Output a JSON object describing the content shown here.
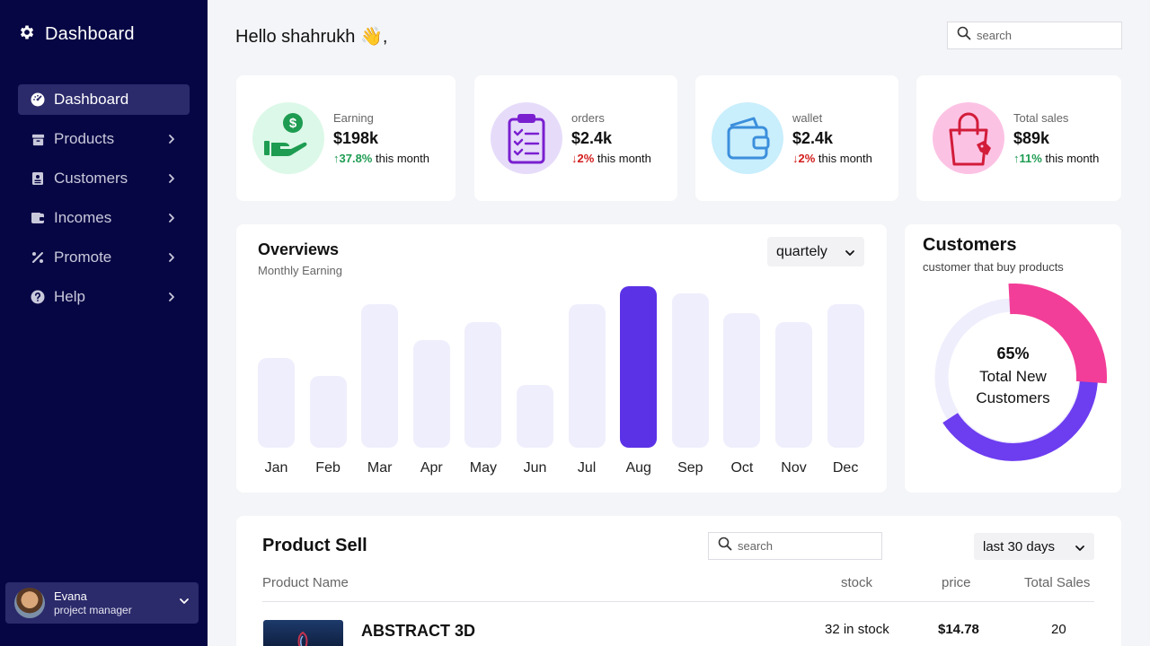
{
  "sidebar": {
    "brand": "Dashboard",
    "items": [
      {
        "label": "Dashboard",
        "icon": "gauge-icon",
        "active": true
      },
      {
        "label": "Products",
        "icon": "box-icon",
        "active": false
      },
      {
        "label": "Customers",
        "icon": "id-card-icon",
        "active": false
      },
      {
        "label": "Incomes",
        "icon": "wallet-icon",
        "active": false
      },
      {
        "label": "Promote",
        "icon": "percent-icon",
        "active": false
      },
      {
        "label": "Help",
        "icon": "question-icon",
        "active": false
      }
    ],
    "profile": {
      "name": "Evana",
      "role": "project manager"
    }
  },
  "header": {
    "greeting": "Hello shahrukh 👋,",
    "search_placeholder": "search"
  },
  "stats": [
    {
      "label": "Earning",
      "value": "$198k",
      "change": "37.8%",
      "direction": "up",
      "suffix": " this month",
      "icon": "dollar-hand-icon",
      "bg": "#dcf8e8",
      "color": "#1e9c52"
    },
    {
      "label": "orders",
      "value": "$2.4k",
      "change": "2%",
      "direction": "down",
      "suffix": " this month",
      "icon": "clipboard-icon",
      "bg": "#e6dcfa",
      "color": "#7a1fd0"
    },
    {
      "label": "wallet",
      "value": "$2.4k",
      "change": "2%",
      "direction": "down",
      "suffix": " this month",
      "icon": "wallet-icon",
      "bg": "#c9eefc",
      "color": "#3b8fdc"
    },
    {
      "label": "Total sales",
      "value": "$89k",
      "change": "11%",
      "direction": "up",
      "suffix": " this month",
      "icon": "shopping-bag-icon",
      "bg": "#fcc2e4",
      "color": "#d21c3a"
    }
  ],
  "overview": {
    "title": "Overviews",
    "subtitle": "Monthly Earning",
    "period": "quartely"
  },
  "chart_data": {
    "type": "bar",
    "categories": [
      "Jan",
      "Feb",
      "Mar",
      "Apr",
      "May",
      "Jun",
      "Jul",
      "Aug",
      "Sep",
      "Oct",
      "Nov",
      "Dec"
    ],
    "values": [
      50,
      40,
      80,
      60,
      70,
      35,
      80,
      90,
      86,
      75,
      70,
      80
    ],
    "highlight": "Aug",
    "highlight_color": "#5b32e6",
    "bar_color": "#efeefc",
    "ylim": [
      0,
      100
    ]
  },
  "customers": {
    "title": "Customers",
    "subtitle": "customer that buy products",
    "percent": "65%",
    "center_label": "Total New Customers",
    "colors": {
      "primary": "#6d3df0",
      "accent": "#f23e98",
      "track": "#efeefc"
    }
  },
  "product_sell": {
    "title": "Product Sell",
    "search_placeholder": "search",
    "period": "last 30 days",
    "columns": {
      "name": "Product Name",
      "stock": "stock",
      "price": "price",
      "sales": "Total Sales"
    },
    "rows": [
      {
        "name": "ABSTRACT 3D",
        "stock": "32 in stock",
        "price": "$14.78",
        "sales": "20"
      }
    ]
  }
}
